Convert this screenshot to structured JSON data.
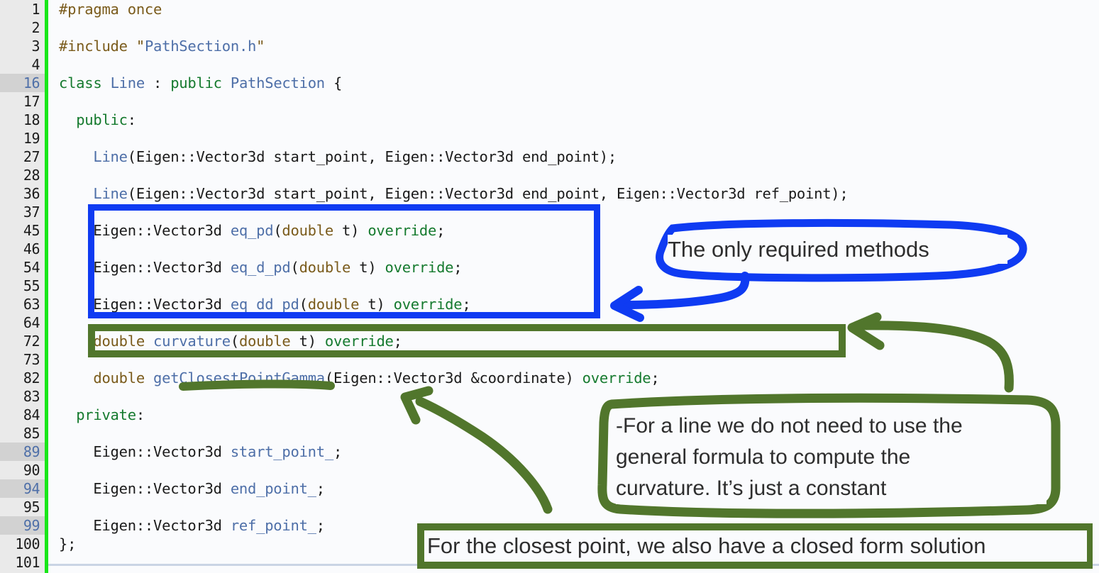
{
  "editor": {
    "gutter": {
      "lines": [
        {
          "n": "1",
          "hl": false
        },
        {
          "n": "2",
          "hl": false
        },
        {
          "n": "3",
          "hl": false
        },
        {
          "n": "4",
          "hl": false
        },
        {
          "n": "16",
          "hl": true
        },
        {
          "n": "17",
          "hl": false
        },
        {
          "n": "18",
          "hl": false
        },
        {
          "n": "19",
          "hl": false
        },
        {
          "n": "27",
          "hl": false
        },
        {
          "n": "28",
          "hl": false
        },
        {
          "n": "36",
          "hl": false
        },
        {
          "n": "37",
          "hl": false
        },
        {
          "n": "45",
          "hl": false
        },
        {
          "n": "46",
          "hl": false
        },
        {
          "n": "54",
          "hl": false
        },
        {
          "n": "55",
          "hl": false
        },
        {
          "n": "63",
          "hl": false
        },
        {
          "n": "64",
          "hl": false
        },
        {
          "n": "72",
          "hl": false
        },
        {
          "n": "73",
          "hl": false
        },
        {
          "n": "82",
          "hl": false
        },
        {
          "n": "83",
          "hl": false
        },
        {
          "n": "84",
          "hl": false
        },
        {
          "n": "85",
          "hl": false
        },
        {
          "n": "89",
          "hl": true
        },
        {
          "n": "90",
          "hl": false
        },
        {
          "n": "94",
          "hl": true
        },
        {
          "n": "95",
          "hl": false
        },
        {
          "n": "99",
          "hl": true
        },
        {
          "n": "100",
          "hl": false
        },
        {
          "n": "101",
          "hl": false
        }
      ]
    },
    "language": "cpp",
    "code_lines": [
      [
        {
          "t": "#pragma once",
          "c": "pre"
        }
      ],
      [],
      [
        {
          "t": "#include ",
          "c": "pre"
        },
        {
          "t": "\"",
          "c": "pre"
        },
        {
          "t": "PathSection.h",
          "c": "str"
        },
        {
          "t": "\"",
          "c": "pre"
        }
      ],
      [],
      [
        {
          "t": "class ",
          "c": "kw"
        },
        {
          "t": "Line",
          "c": "typ"
        },
        {
          "t": " : ",
          "c": "pl"
        },
        {
          "t": "public ",
          "c": "kw"
        },
        {
          "t": "PathSection",
          "c": "typ"
        },
        {
          "t": " {",
          "c": "pl"
        }
      ],
      [],
      [
        {
          "t": "  ",
          "c": "pl"
        },
        {
          "t": "public",
          "c": "kw"
        },
        {
          "t": ":",
          "c": "pl"
        }
      ],
      [],
      [
        {
          "t": "    ",
          "c": "pl"
        },
        {
          "t": "Line",
          "c": "fn"
        },
        {
          "t": "(Eigen::Vector3d start_point, Eigen::Vector3d end_point);",
          "c": "pl"
        }
      ],
      [],
      [
        {
          "t": "    ",
          "c": "pl"
        },
        {
          "t": "Line",
          "c": "fn"
        },
        {
          "t": "(Eigen::Vector3d start_point, Eigen::Vector3d end_point, Eigen::Vector3d ref_point);",
          "c": "pl"
        }
      ],
      [],
      [
        {
          "t": "    Eigen::Vector3d ",
          "c": "pl"
        },
        {
          "t": "eq_pd",
          "c": "fn"
        },
        {
          "t": "(",
          "c": "pl"
        },
        {
          "t": "double",
          "c": "bi"
        },
        {
          "t": " t) ",
          "c": "pl"
        },
        {
          "t": "override",
          "c": "kw"
        },
        {
          "t": ";",
          "c": "pl"
        }
      ],
      [],
      [
        {
          "t": "    Eigen::Vector3d ",
          "c": "pl"
        },
        {
          "t": "eq_d_pd",
          "c": "fn"
        },
        {
          "t": "(",
          "c": "pl"
        },
        {
          "t": "double",
          "c": "bi"
        },
        {
          "t": " t) ",
          "c": "pl"
        },
        {
          "t": "override",
          "c": "kw"
        },
        {
          "t": ";",
          "c": "pl"
        }
      ],
      [],
      [
        {
          "t": "    Eigen::Vector3d ",
          "c": "pl"
        },
        {
          "t": "eq_dd_pd",
          "c": "fn"
        },
        {
          "t": "(",
          "c": "pl"
        },
        {
          "t": "double",
          "c": "bi"
        },
        {
          "t": " t) ",
          "c": "pl"
        },
        {
          "t": "override",
          "c": "kw"
        },
        {
          "t": ";",
          "c": "pl"
        }
      ],
      [],
      [
        {
          "t": "    ",
          "c": "pl"
        },
        {
          "t": "double",
          "c": "bi"
        },
        {
          "t": " ",
          "c": "pl"
        },
        {
          "t": "curvature",
          "c": "fn"
        },
        {
          "t": "(",
          "c": "pl"
        },
        {
          "t": "double",
          "c": "bi"
        },
        {
          "t": " t) ",
          "c": "pl"
        },
        {
          "t": "override",
          "c": "kw"
        },
        {
          "t": ";",
          "c": "pl"
        }
      ],
      [],
      [
        {
          "t": "    ",
          "c": "pl"
        },
        {
          "t": "double",
          "c": "bi"
        },
        {
          "t": " ",
          "c": "pl"
        },
        {
          "t": "getClosestPointGamma",
          "c": "fn"
        },
        {
          "t": "(Eigen::Vector3d &coordinate) ",
          "c": "pl"
        },
        {
          "t": "override",
          "c": "kw"
        },
        {
          "t": ";",
          "c": "pl"
        }
      ],
      [],
      [
        {
          "t": "  ",
          "c": "pl"
        },
        {
          "t": "private",
          "c": "kw"
        },
        {
          "t": ":",
          "c": "pl"
        }
      ],
      [],
      [
        {
          "t": "    Eigen::Vector3d ",
          "c": "pl"
        },
        {
          "t": "start_point_",
          "c": "typ"
        },
        {
          "t": ";",
          "c": "pl"
        }
      ],
      [],
      [
        {
          "t": "    Eigen::Vector3d ",
          "c": "pl"
        },
        {
          "t": "end_point_",
          "c": "typ"
        },
        {
          "t": ";",
          "c": "pl"
        }
      ],
      [],
      [
        {
          "t": "    Eigen::Vector3d ",
          "c": "pl"
        },
        {
          "t": "ref_point_",
          "c": "typ"
        },
        {
          "t": ";",
          "c": "pl"
        }
      ],
      [
        {
          "t": "};",
          "c": "pl"
        }
      ],
      []
    ]
  },
  "annotations": {
    "blue": {
      "color": "#0f3bf2",
      "label": "The only required methods",
      "highlight_box_label": "eq_pd / eq_d_pd / eq_dd_pd declarations"
    },
    "green": {
      "color": "#51762c",
      "curvature_box_label": "curvature declaration",
      "note": "-For a line we do not need to use the general formula to compute the curvature. It’s just a constant",
      "note_lines": [
        "-For a line we do not need to use the",
        "general formula to compute the",
        "curvature. It’s just a constant"
      ],
      "bottom_note": "For the closest point, we also have a closed form solution"
    }
  },
  "colors": {
    "background": "#fafbfd",
    "gutter_background": "#eaeaea",
    "gutter_highlight": "#d2d2d2",
    "gutter_rule": "#19e619",
    "preprocessor": "#7a5b1b",
    "keyword": "#157a2e",
    "type": "#4e6fa8",
    "plain": "#1b1b1b",
    "annotation_blue": "#0f3bf2",
    "annotation_green": "#51762c"
  }
}
